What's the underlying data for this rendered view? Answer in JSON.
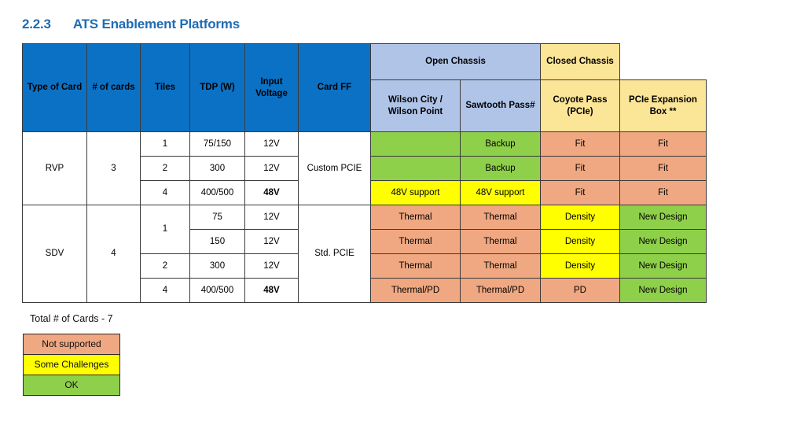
{
  "title": {
    "number": "2.2.3",
    "text": "ATS Enablement Platforms"
  },
  "colors": {
    "header_blue": "#0b71c4",
    "open_chassis_blue": "#b0c4e8",
    "closed_chassis_tan": "#fbe596",
    "status_ok_green": "#8fd04a",
    "status_not_supported_salmon": "#f0a882",
    "status_some_challenges_yellow": "#ffff00",
    "title_blue": "#1f6cb4",
    "red_text": "#e8251b"
  },
  "table": {
    "headers": {
      "type_of_card": "Type of Card",
      "num_of_cards": "# of cards",
      "tiles": "Tiles",
      "tdp": "TDP (W)",
      "input_voltage": "Input Voltage",
      "card_ff": "Card FF",
      "open_chassis": "Open Chassis",
      "closed_chassis": "Closed Chassis",
      "wilson": "Wilson City / Wilson Point",
      "sawtooth": "Sawtooth Pass#",
      "coyote": "Coyote Pass (PCIe)",
      "pcie_box": "PCIe Expansion Box **"
    },
    "groups": [
      {
        "type": "RVP",
        "num_cards": "3",
        "card_ff": "Custom PCIE",
        "rows": [
          {
            "tiles": "1",
            "tdp": "75/150",
            "voltage": "12V",
            "voltage_red": false,
            "wilson": "",
            "wilson_fill": "green",
            "sawtooth": "Backup",
            "sawtooth_fill": "green",
            "sawtooth_red": false,
            "coyote": "Fit",
            "coyote_fill": "salmon",
            "coyote_red": true,
            "pcie_box": "Fit",
            "pcie_box_fill": "salmon",
            "pcie_box_red": true
          },
          {
            "tiles": "2",
            "tdp": "300",
            "voltage": "12V",
            "voltage_red": false,
            "wilson": "",
            "wilson_fill": "green",
            "sawtooth": "Backup",
            "sawtooth_fill": "green",
            "sawtooth_red": false,
            "coyote": "Fit",
            "coyote_fill": "salmon",
            "coyote_red": true,
            "pcie_box": "Fit",
            "pcie_box_fill": "salmon",
            "pcie_box_red": true
          },
          {
            "tiles": "4",
            "tdp": "400/500",
            "voltage": "48V",
            "voltage_red": true,
            "wilson": "48V support",
            "wilson_fill": "yellow",
            "wilson_red": false,
            "sawtooth": "48V support",
            "sawtooth_fill": "yellow",
            "sawtooth_red": false,
            "coyote": "Fit",
            "coyote_fill": "salmon",
            "coyote_red": true,
            "pcie_box": "Fit",
            "pcie_box_fill": "salmon",
            "pcie_box_red": true
          }
        ]
      },
      {
        "type": "SDV",
        "num_cards": "4",
        "card_ff": "Std. PCIE",
        "rows": [
          {
            "tiles": "1",
            "tiles_rowspan": 2,
            "tdp": "75",
            "voltage": "12V",
            "voltage_red": false,
            "wilson": "Thermal",
            "wilson_fill": "salmon",
            "wilson_red": true,
            "sawtooth": "Thermal",
            "sawtooth_fill": "salmon",
            "sawtooth_red": true,
            "coyote": "Density",
            "coyote_fill": "yellow",
            "coyote_red": false,
            "pcie_box": "New Design",
            "pcie_box_fill": "green",
            "pcie_box_red": false
          },
          {
            "tiles": "",
            "tdp": "150",
            "voltage": "12V",
            "voltage_red": false,
            "wilson": "Thermal",
            "wilson_fill": "salmon",
            "wilson_red": true,
            "sawtooth": "Thermal",
            "sawtooth_fill": "salmon",
            "sawtooth_red": true,
            "coyote": "Density",
            "coyote_fill": "yellow",
            "coyote_red": false,
            "pcie_box": "New Design",
            "pcie_box_fill": "green",
            "pcie_box_red": false
          },
          {
            "tiles": "2",
            "tdp": "300",
            "voltage": "12V",
            "voltage_red": false,
            "wilson": "Thermal",
            "wilson_fill": "salmon",
            "wilson_red": true,
            "sawtooth": "Thermal",
            "sawtooth_fill": "salmon",
            "sawtooth_red": true,
            "coyote": "Density",
            "coyote_fill": "yellow",
            "coyote_red": false,
            "pcie_box": "New Design",
            "pcie_box_fill": "green",
            "pcie_box_red": false
          },
          {
            "tiles": "4",
            "tdp": "400/500",
            "voltage": "48V",
            "voltage_red": true,
            "wilson": "Thermal/PD",
            "wilson_fill": "salmon",
            "wilson_red": true,
            "sawtooth": "Thermal/PD",
            "sawtooth_fill": "salmon",
            "sawtooth_red": true,
            "coyote": "PD",
            "coyote_fill": "salmon",
            "coyote_red": true,
            "pcie_box": "New Design",
            "pcie_box_fill": "green",
            "pcie_box_red": false
          }
        ]
      }
    ]
  },
  "footer": {
    "total_cards": "Total # of Cards - 7"
  },
  "legend": {
    "items": [
      {
        "label": "Not supported",
        "fill": "salmon"
      },
      {
        "label": "Some Challenges",
        "fill": "yellow"
      },
      {
        "label": "OK",
        "fill": "green"
      }
    ]
  }
}
